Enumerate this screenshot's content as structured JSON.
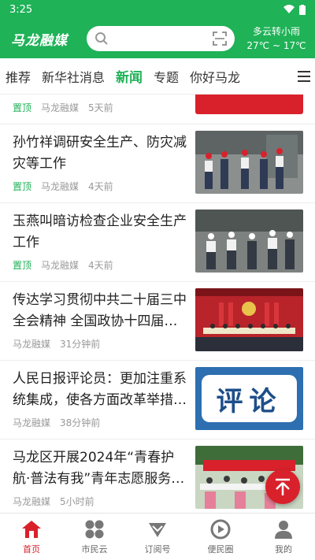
{
  "status": {
    "time": "3:25"
  },
  "header": {
    "logo": "马龙融媒",
    "weather_condition": "多云转小雨",
    "weather_temp": "27℃ ~ 17℃"
  },
  "tabs": [
    {
      "label": "推荐",
      "active": false
    },
    {
      "label": "新华社消息",
      "active": false
    },
    {
      "label": "新闻",
      "active": true
    },
    {
      "label": "专题",
      "active": false
    },
    {
      "label": "你好马龙",
      "active": false
    }
  ],
  "feed": {
    "partial": {
      "pin": "置顶",
      "source": "马龙融媒",
      "time": "5天前"
    },
    "items": [
      {
        "title": "孙竹祥调研安全生产、防灾减灾等工作",
        "pin": "置顶",
        "source": "马龙融媒",
        "time": "4天前"
      },
      {
        "title": "玉燕叫暗访检查企业安全生产工作",
        "pin": "置顶",
        "source": "马龙融媒",
        "time": "4天前"
      },
      {
        "title": "传达学习贯彻中共二十届三中全会精神 全国政协十四届常委会第七次会议",
        "pin": "",
        "source": "马龙融媒",
        "time": "31分钟前"
      },
      {
        "title": "人民日报评论员：更加注重系统集成，使各方面改革举措相互配合",
        "pin": "",
        "source": "马龙融媒",
        "time": "38分钟前",
        "thumb_text": "评论"
      },
      {
        "title": "马龙区开展2024年“青春护航·普法有我”青年志愿服务活动",
        "pin": "",
        "source": "马龙融媒",
        "time": "5小时前"
      }
    ]
  },
  "bottom_nav": [
    {
      "label": "首页",
      "icon": "home-icon",
      "active": true
    },
    {
      "label": "市民云",
      "icon": "cloud-grid-icon",
      "active": false
    },
    {
      "label": "订阅号",
      "icon": "subscribe-icon",
      "active": false
    },
    {
      "label": "便民圈",
      "icon": "circle-play-icon",
      "active": false
    },
    {
      "label": "我的",
      "icon": "user-icon",
      "active": false
    }
  ],
  "colors": {
    "brand_green": "#1fb257",
    "accent_red": "#d9212b"
  }
}
